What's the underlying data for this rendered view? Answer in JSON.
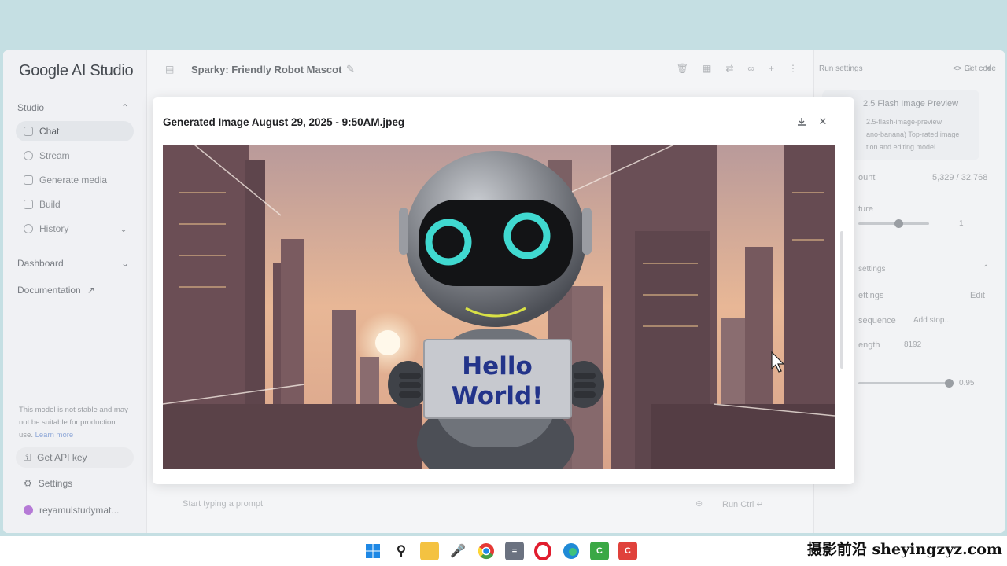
{
  "app": {
    "logo": "Google AI Studio"
  },
  "sidebar": {
    "studio_label": "Studio",
    "items": [
      {
        "label": "Chat",
        "icon": "chat-icon"
      },
      {
        "label": "Stream",
        "icon": "stream-icon"
      },
      {
        "label": "Generate media",
        "icon": "media-icon"
      },
      {
        "label": "Build",
        "icon": "build-icon"
      },
      {
        "label": "History",
        "icon": "history-icon"
      }
    ],
    "dashboard_label": "Dashboard",
    "documentation_label": "Documentation",
    "note": "This model is not stable and may not be suitable for production use.",
    "note_link": "Learn more",
    "api_key_label": "Get API key",
    "settings_label": "Settings",
    "account": "reyamulstudymat..."
  },
  "topbar": {
    "title": "Sparky: Friendly Robot Mascot"
  },
  "run_settings": {
    "header": "Run settings",
    "get_code": "Get code",
    "model_name": "2.5 Flash Image Preview",
    "model_desc_1": "2.5-flash-image-preview",
    "model_desc_2": "ano-banana) Top-rated image",
    "model_desc_3": "tion and editing model.",
    "token_label": "ount",
    "token_value": "5,329 / 32,768",
    "temperature_label": "ture",
    "temperature_value": "1",
    "advanced_label": "settings",
    "safety_label": "ettings",
    "safety_edit": "Edit",
    "stop_label": "sequence",
    "stop_placeholder": "Add stop...",
    "length_label": "ength",
    "length_value": "8192",
    "topp_value": "0.95"
  },
  "prompt": {
    "placeholder": "Start typing a prompt",
    "run_label": "Run",
    "shortcut": "Ctrl ↵"
  },
  "modal": {
    "title": "Generated Image August 29, 2025 - 9:50AM.jpeg",
    "sign_line1": "Hello",
    "sign_line2": "World!"
  },
  "taskbar": {
    "apps": [
      "windows-start",
      "search",
      "file-explorer",
      "microphone",
      "chrome",
      "calculator",
      "opera",
      "edge",
      "camtasia-green",
      "camtasia-red"
    ]
  },
  "watermark": "摄影前沿 sheyingzyz.com",
  "colors": {
    "accent_eye": "#40d9d0",
    "sign_text": "#23348a",
    "sky": "#e9b99a"
  }
}
